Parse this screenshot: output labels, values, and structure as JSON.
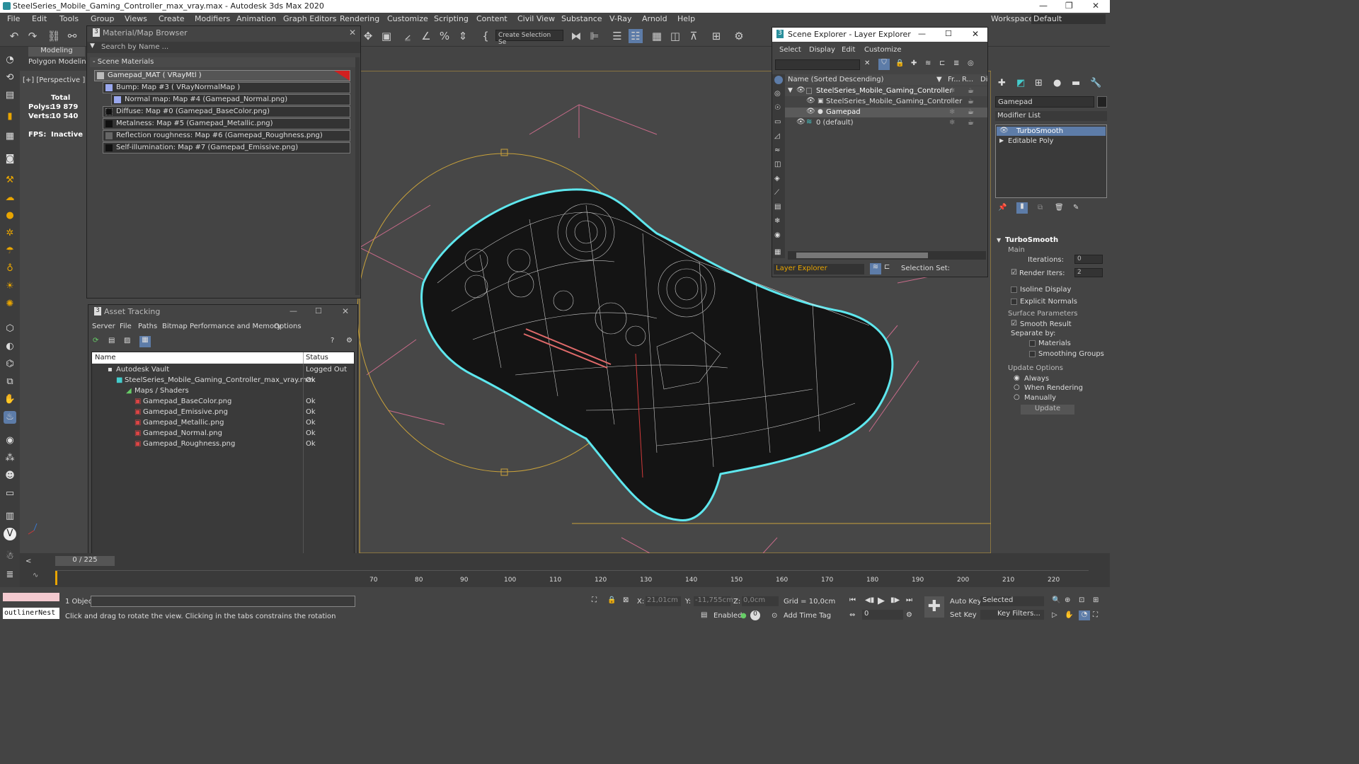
{
  "window": {
    "title": "SteelSeries_Mobile_Gaming_Controller_max_vray.max - Autodesk 3ds Max 2020"
  },
  "menu": [
    "File",
    "Edit",
    "Tools",
    "Group",
    "Views",
    "Create",
    "Modifiers",
    "Animation",
    "Graph Editors",
    "Rendering",
    "Customize",
    "Scripting",
    "Content",
    "Civil View",
    "Substance",
    "V-Ray",
    "Arnold",
    "Help"
  ],
  "workspace": {
    "label": "Workspaces:",
    "value": "Default"
  },
  "toolbar": {
    "selection_set": "Create Selection Se"
  },
  "ribbon": {
    "tab": "Modeling",
    "sub": "Polygon Modeling"
  },
  "viewport": {
    "label": "[+] [Perspective ] [St",
    "stats": {
      "total": "Total",
      "polys_label": "Polys:",
      "polys": "19 879",
      "verts_label": "Verts:",
      "verts": "10 540",
      "fps_label": "FPS:",
      "fps": "Inactive"
    }
  },
  "material_browser": {
    "title": "Material/Map Browser",
    "search": "Search by Name ...",
    "section": "- Scene Materials",
    "items": [
      "Gamepad_MAT  ( VRayMtl )",
      "Bump: Map #3  ( VRayNormalMap )",
      "Normal map: Map #4 (Gamepad_Normal.png)",
      "Diffuse: Map #0 (Gamepad_BaseColor.png)",
      "Metalness: Map #5 (Gamepad_Metallic.png)",
      "Reflection roughness: Map #6 (Gamepad_Roughness.png)",
      "Self-illumination: Map #7 (Gamepad_Emissive.png)"
    ]
  },
  "asset_tracking": {
    "title": "Asset Tracking",
    "menu": [
      "Server",
      "File",
      "Paths",
      "Bitmap Performance and Memory",
      "Options"
    ],
    "col_name": "Name",
    "col_status": "Status",
    "rows": [
      {
        "name": "Autodesk Vault",
        "status": "Logged Out ..."
      },
      {
        "name": "SteelSeries_Mobile_Gaming_Controller_max_vray.max",
        "status": "Ok"
      },
      {
        "name": "Maps / Shaders",
        "status": ""
      },
      {
        "name": "Gamepad_BaseColor.png",
        "status": "Ok"
      },
      {
        "name": "Gamepad_Emissive.png",
        "status": "Ok"
      },
      {
        "name": "Gamepad_Metallic.png",
        "status": "Ok"
      },
      {
        "name": "Gamepad_Normal.png",
        "status": "Ok"
      },
      {
        "name": "Gamepad_Roughness.png",
        "status": "Ok"
      }
    ]
  },
  "scene_explorer": {
    "title": "Scene Explorer - Layer Explorer",
    "menu": [
      "Select",
      "Display",
      "Edit",
      "Customize"
    ],
    "col_name": "Name (Sorted Descending)",
    "col_fr": "Fr...",
    "col_r": "R...",
    "col_d": "Di",
    "rows": [
      "SteelSeries_Mobile_Gaming_Controller",
      "SteelSeries_Mobile_Gaming_Controller",
      "Gamepad",
      "0 (default)"
    ],
    "footer_left": "Layer Explorer",
    "footer_right": "Selection Set:"
  },
  "command_panel": {
    "object_name": "Gamepad",
    "modifier_list": "Modifier List",
    "stack": [
      "TurboSmooth",
      "Editable Poly"
    ],
    "rollout": "TurboSmooth",
    "main": "Main",
    "iterations_label": "Iterations:",
    "iterations": "0",
    "render_iters_label": "Render Iters:",
    "render_iters": "2",
    "isoline": "Isoline Display",
    "explicit": "Explicit Normals",
    "surface": "Surface Parameters",
    "smooth_result": "Smooth Result",
    "separate": "Separate by:",
    "materials": "Materials",
    "smoothing": "Smoothing Groups",
    "update_options": "Update Options",
    "always": "Always",
    "when_rendering": "When Rendering",
    "manually": "Manually",
    "update": "Update"
  },
  "timeline": {
    "frame": "0 / 225",
    "ticks": [
      "70",
      "80",
      "90",
      "100",
      "110",
      "120",
      "130",
      "140",
      "150",
      "160",
      "170",
      "180",
      "190",
      "200",
      "210",
      "220"
    ]
  },
  "status": {
    "script": "outlinerNest",
    "objects": "1 Object",
    "prompt": "Click and drag to rotate the view.  Clicking in the tabs constrains the rotation",
    "x_label": "X:",
    "x": "21,01cm",
    "y_label": "Y:",
    "y": "-11,755cm",
    "z_label": "Z:",
    "z": "0,0cm",
    "grid": "Grid = 10,0cm",
    "enabled": "Enabled:",
    "add_time_tag": "Add Time Tag",
    "auto_key": "Auto Key",
    "selected": "Selected",
    "set_key": "Set Key",
    "key_filters": "Key Filters...",
    "frame": "0"
  }
}
